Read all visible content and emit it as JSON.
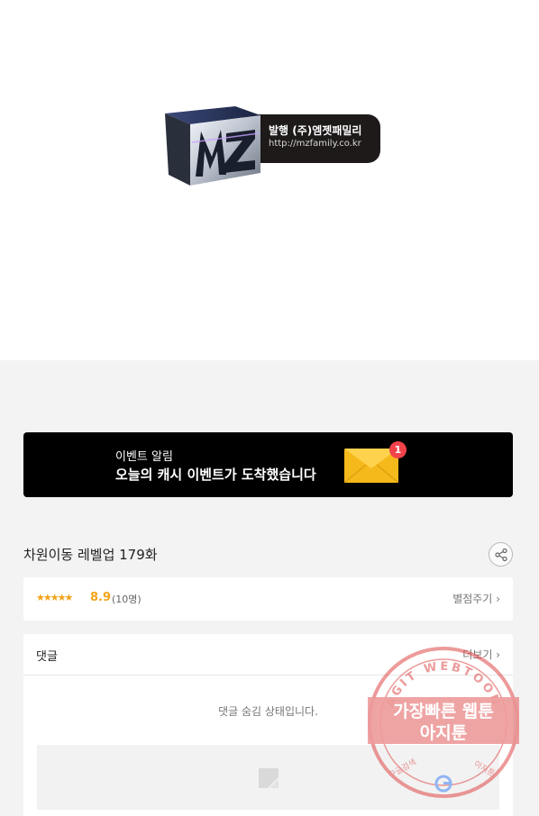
{
  "publisher": {
    "logo_text": "MZ",
    "name": "발행 (주)엠젯패밀리",
    "url": "http://mzfamily.co.kr"
  },
  "event_banner": {
    "label": "이벤트 알림",
    "title": "오늘의 캐시 이벤트가 도착했습니다",
    "badge_count": "1",
    "icon": "envelope-icon"
  },
  "episode": {
    "title": "차원이동 레벨업 179화"
  },
  "rating": {
    "stars": "★★★★★",
    "score": "8.9",
    "count": "(10명)",
    "rate_link": "별점주기"
  },
  "comments": {
    "title": "댓글",
    "more": "더보기",
    "hidden_notice": "댓글 숨김 상태입니다."
  },
  "watermark": {
    "arc_text": "AGIT WEBTOON",
    "line1": "가장빠른 웹툰",
    "line2": "아지툰",
    "bottom_left": "구글검색",
    "bottom_right": "아지툰"
  },
  "colors": {
    "accent_rating": "#f3a31a",
    "badge": "#f2434a",
    "banner_bg": "#000000",
    "stamp": "#e04848"
  }
}
